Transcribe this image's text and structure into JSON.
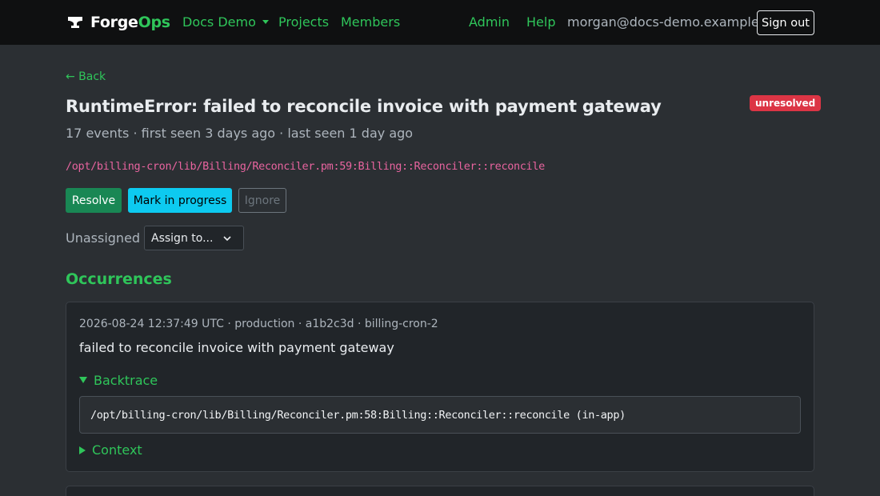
{
  "navbar": {
    "brand_forge": "Forge",
    "brand_ops": "Ops",
    "project_menu": "Docs Demo",
    "projects": "Projects",
    "members": "Members",
    "admin": "Admin",
    "help": "Help",
    "user_email": "morgan@docs-demo.example",
    "sign_out": "Sign out"
  },
  "issue": {
    "back": "← Back",
    "title": "RuntimeError: failed to reconcile invoice with payment gateway",
    "status_badge": "unresolved",
    "meta": "17 events · first seen 3 days ago · last seen 1 day ago",
    "location": "/opt/billing-cron/lib/Billing/Reconciler.pm:59:Billing::Reconciler::reconcile",
    "actions": {
      "resolve": "Resolve",
      "mark_in_progress": "Mark in progress",
      "ignore": "Ignore"
    },
    "assignee_label": "Unassigned",
    "assign_select": "Assign to..."
  },
  "occurrences": {
    "heading": "Occurrences",
    "items": [
      {
        "meta": "2026-08-24 12:37:49 UTC · production · a1b2c3d · billing-cron-2",
        "message": "failed to reconcile invoice with payment gateway",
        "backtrace_label": "Backtrace",
        "backtrace_line": "/opt/billing-cron/lib/Billing/Reconciler.pm:58:Billing::Reconciler::reconcile (in-app)",
        "context_label": "Context"
      }
    ]
  },
  "colors": {
    "accent_green": "#2fc55a",
    "badge_red": "#dc3545",
    "resolve_green": "#198754",
    "progress_cyan": "#0dcaf0",
    "location_pink": "#e8649f"
  },
  "icons": {
    "brand": "anvil-icon",
    "dropdown": "caret-down-icon",
    "select": "chevron-down-icon",
    "expanded": "triangle-down-icon",
    "collapsed": "triangle-right-icon"
  }
}
